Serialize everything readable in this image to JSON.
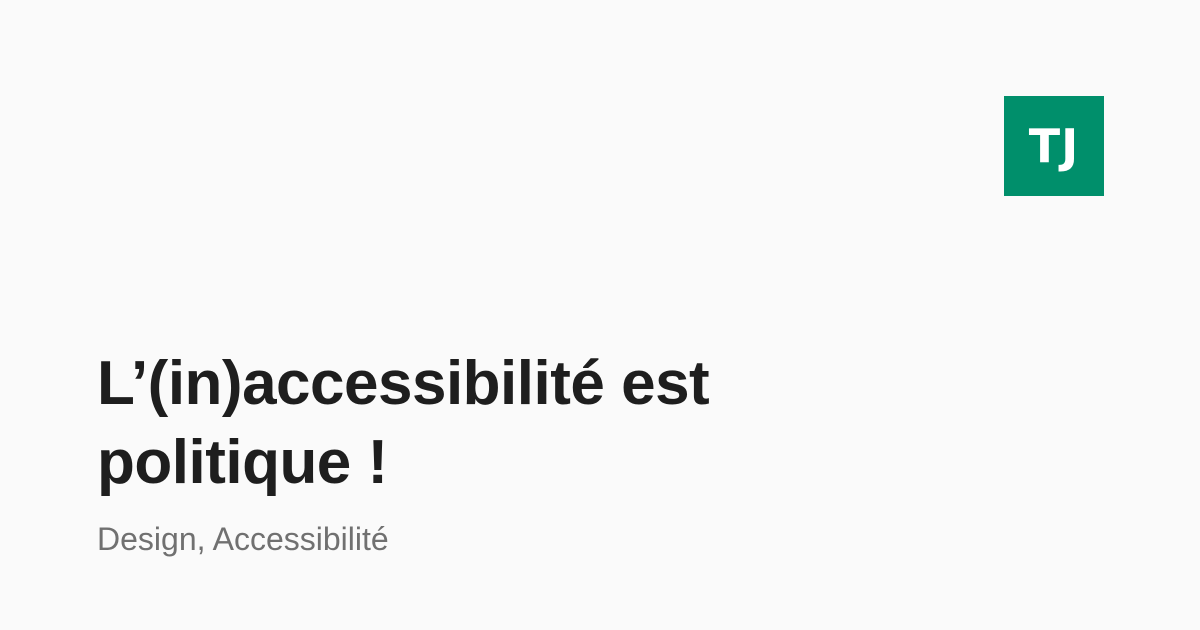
{
  "brand": {
    "logo_text": "TJ",
    "logo_color": "#008f6b"
  },
  "article": {
    "title": "L’(in)accessibilité est politique !",
    "tags": "Design, Accessibilité"
  },
  "colors": {
    "background": "#fafafa",
    "title": "#1e1e1e",
    "tags": "#707070"
  }
}
